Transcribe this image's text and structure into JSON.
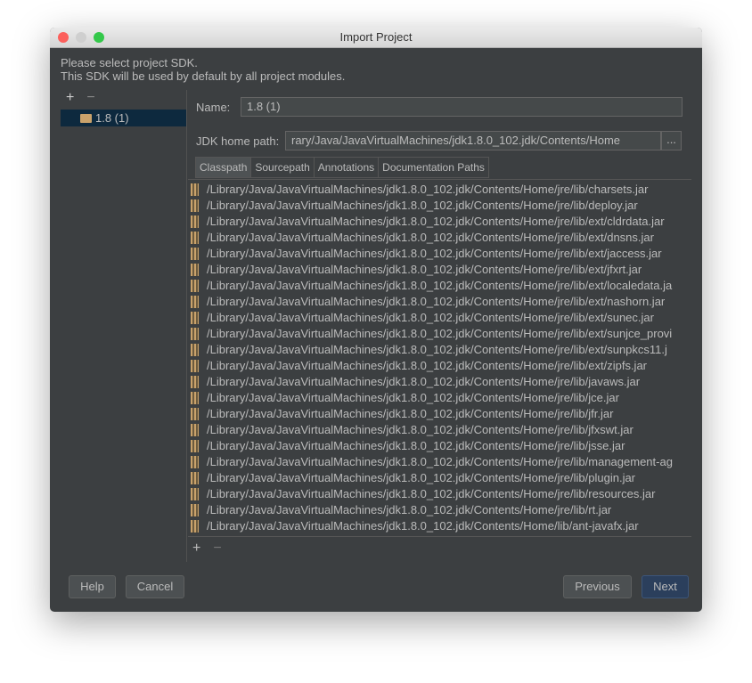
{
  "window": {
    "title": "Import Project"
  },
  "description": [
    "Please select project SDK.",
    "This SDK will be used by default by all project modules."
  ],
  "sidebar": {
    "add": "+",
    "remove": "−",
    "items": [
      {
        "label": "1.8 (1)",
        "icon": "jdk-folder-icon"
      }
    ]
  },
  "form": {
    "name_label": "Name:",
    "name_value": "1.8 (1)",
    "jdk_label": "JDK home path:",
    "jdk_value": "rary/Java/JavaVirtualMachines/jdk1.8.0_102.jdk/Contents/Home",
    "browse": "..."
  },
  "tabs": [
    "Classpath",
    "Sourcepath",
    "Annotations",
    "Documentation Paths"
  ],
  "classpath": [
    "/Library/Java/JavaVirtualMachines/jdk1.8.0_102.jdk/Contents/Home/jre/lib/charsets.jar",
    "/Library/Java/JavaVirtualMachines/jdk1.8.0_102.jdk/Contents/Home/jre/lib/deploy.jar",
    "/Library/Java/JavaVirtualMachines/jdk1.8.0_102.jdk/Contents/Home/jre/lib/ext/cldrdata.jar",
    "/Library/Java/JavaVirtualMachines/jdk1.8.0_102.jdk/Contents/Home/jre/lib/ext/dnsns.jar",
    "/Library/Java/JavaVirtualMachines/jdk1.8.0_102.jdk/Contents/Home/jre/lib/ext/jaccess.jar",
    "/Library/Java/JavaVirtualMachines/jdk1.8.0_102.jdk/Contents/Home/jre/lib/ext/jfxrt.jar",
    "/Library/Java/JavaVirtualMachines/jdk1.8.0_102.jdk/Contents/Home/jre/lib/ext/localedata.ja",
    "/Library/Java/JavaVirtualMachines/jdk1.8.0_102.jdk/Contents/Home/jre/lib/ext/nashorn.jar",
    "/Library/Java/JavaVirtualMachines/jdk1.8.0_102.jdk/Contents/Home/jre/lib/ext/sunec.jar",
    "/Library/Java/JavaVirtualMachines/jdk1.8.0_102.jdk/Contents/Home/jre/lib/ext/sunjce_provi",
    "/Library/Java/JavaVirtualMachines/jdk1.8.0_102.jdk/Contents/Home/jre/lib/ext/sunpkcs11.j",
    "/Library/Java/JavaVirtualMachines/jdk1.8.0_102.jdk/Contents/Home/jre/lib/ext/zipfs.jar",
    "/Library/Java/JavaVirtualMachines/jdk1.8.0_102.jdk/Contents/Home/jre/lib/javaws.jar",
    "/Library/Java/JavaVirtualMachines/jdk1.8.0_102.jdk/Contents/Home/jre/lib/jce.jar",
    "/Library/Java/JavaVirtualMachines/jdk1.8.0_102.jdk/Contents/Home/jre/lib/jfr.jar",
    "/Library/Java/JavaVirtualMachines/jdk1.8.0_102.jdk/Contents/Home/jre/lib/jfxswt.jar",
    "/Library/Java/JavaVirtualMachines/jdk1.8.0_102.jdk/Contents/Home/jre/lib/jsse.jar",
    "/Library/Java/JavaVirtualMachines/jdk1.8.0_102.jdk/Contents/Home/jre/lib/management-ag",
    "/Library/Java/JavaVirtualMachines/jdk1.8.0_102.jdk/Contents/Home/jre/lib/plugin.jar",
    "/Library/Java/JavaVirtualMachines/jdk1.8.0_102.jdk/Contents/Home/jre/lib/resources.jar",
    "/Library/Java/JavaVirtualMachines/jdk1.8.0_102.jdk/Contents/Home/jre/lib/rt.jar",
    "/Library/Java/JavaVirtualMachines/jdk1.8.0_102.jdk/Contents/Home/lib/ant-javafx.jar"
  ],
  "list_tools": {
    "add": "+",
    "remove": "−"
  },
  "buttons": {
    "help": "Help",
    "cancel": "Cancel",
    "previous": "Previous",
    "next": "Next"
  },
  "colors": {
    "background": "#3c3f41",
    "selection": "#0d293e",
    "primary_button": "#2b3f5c"
  }
}
